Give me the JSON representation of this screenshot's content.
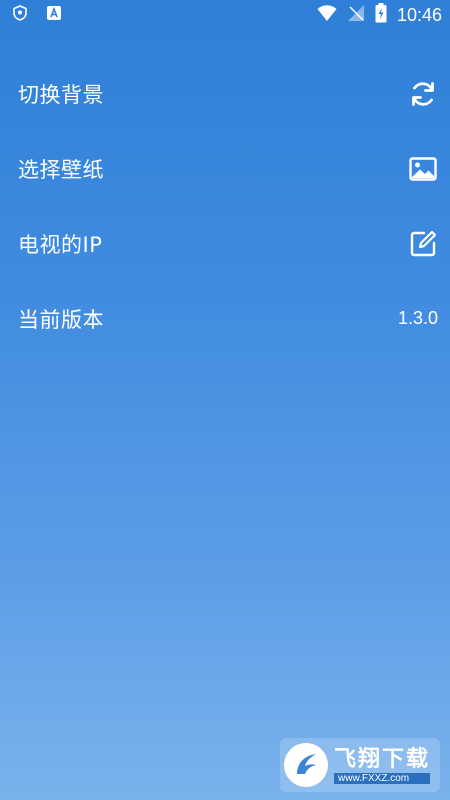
{
  "status_bar": {
    "time": "10:46",
    "icons": [
      "shield-icon",
      "a-notification-icon",
      "wifi-icon",
      "no-signal-icon",
      "battery-charging-icon"
    ]
  },
  "menu": {
    "items": [
      {
        "label": "切换背景",
        "icon": "refresh-icon"
      },
      {
        "label": "选择壁纸",
        "icon": "image-icon"
      },
      {
        "label": "电视的IP",
        "icon": "edit-icon"
      },
      {
        "label": "当前版本",
        "value": "1.3.0"
      }
    ]
  },
  "watermark": {
    "text": "飞翔下载",
    "url": "www.FXXZ.com"
  },
  "colors": {
    "background_top": "#2f7fd8",
    "background_bottom": "#7ab2ec",
    "foreground": "#ffffff"
  }
}
